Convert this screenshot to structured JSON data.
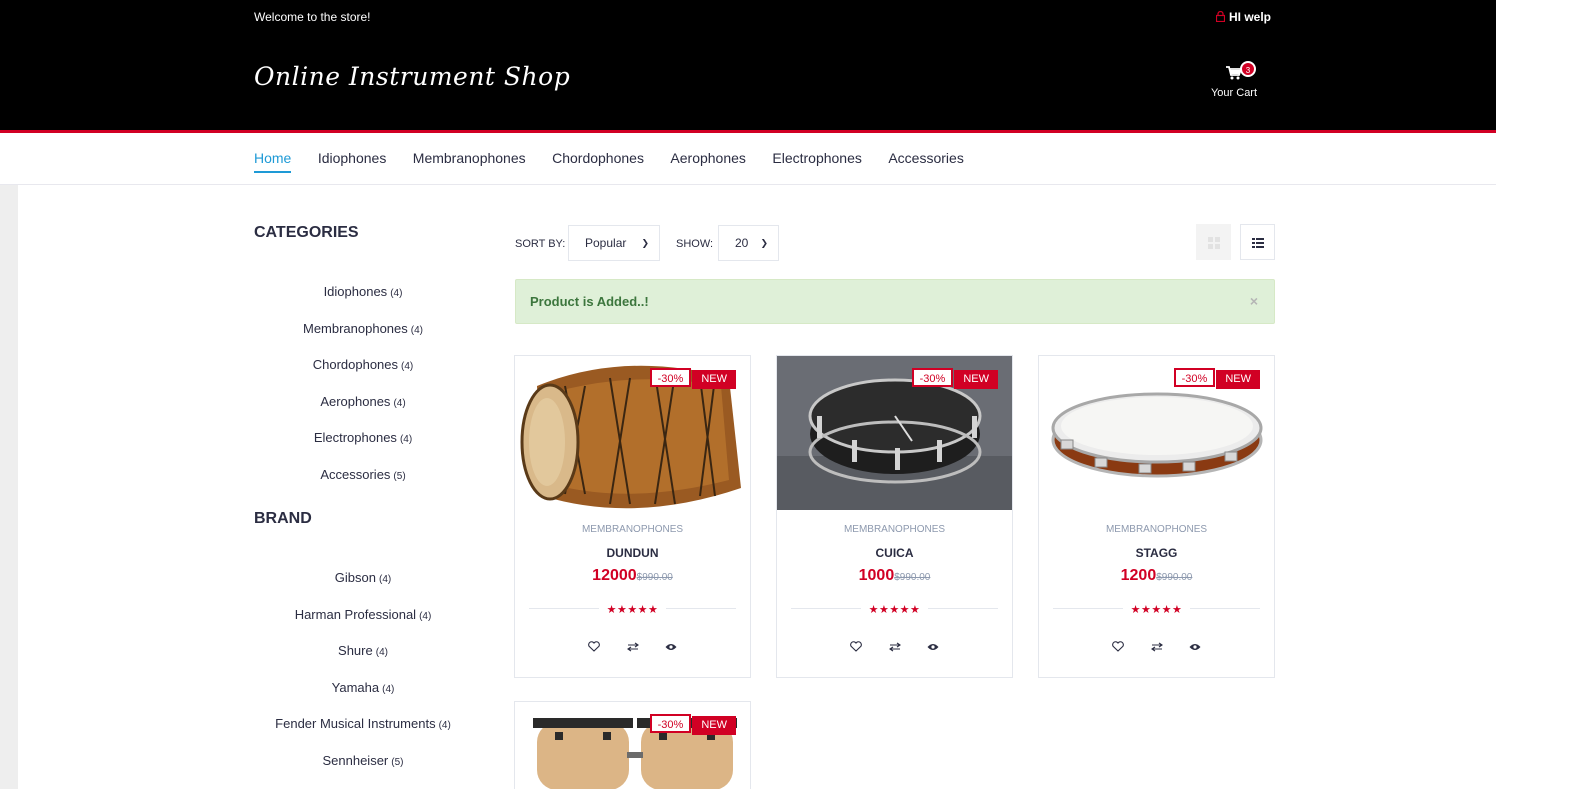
{
  "header": {
    "welcome": "Welcome to the store!",
    "account_greeting": "HI welp",
    "logo": "Online Instrument Shop",
    "cart_label": "Your Cart",
    "cart_count": "3"
  },
  "nav": {
    "items": [
      {
        "label": "Home",
        "active": true
      },
      {
        "label": "Idiophones"
      },
      {
        "label": "Membranophones"
      },
      {
        "label": "Chordophones"
      },
      {
        "label": "Aerophones"
      },
      {
        "label": "Electrophones"
      },
      {
        "label": "Accessories"
      }
    ]
  },
  "sidebar": {
    "categories_title": "CATEGORIES",
    "categories": [
      {
        "name": "Idiophones",
        "count": "(4)"
      },
      {
        "name": "Membranophones",
        "count": "(4)"
      },
      {
        "name": "Chordophones",
        "count": "(4)"
      },
      {
        "name": "Aerophones",
        "count": "(4)"
      },
      {
        "name": "Electrophones",
        "count": "(4)"
      },
      {
        "name": "Accessories",
        "count": "(5)"
      }
    ],
    "brand_title": "BRAND",
    "brands": [
      {
        "name": "Gibson",
        "count": "(4)"
      },
      {
        "name": "Harman Professional",
        "count": "(4)"
      },
      {
        "name": "Shure",
        "count": "(4)"
      },
      {
        "name": "Yamaha",
        "count": "(4)"
      },
      {
        "name": "Fender Musical Instruments",
        "count": "(4)"
      },
      {
        "name": "Sennheiser",
        "count": "(5)"
      }
    ]
  },
  "store_filter": {
    "sort_label": "SORT BY:",
    "sort_value": "Popular",
    "show_label": "SHOW:",
    "show_value": "20"
  },
  "alert": {
    "message": "Product is Added..!",
    "close": "×"
  },
  "products": [
    {
      "sale": "-30%",
      "new": "NEW",
      "category": "MEMBRANOPHONES",
      "name": "DUNDUN",
      "price": "12000",
      "old_price": "$990.00",
      "stars": "★★★★★"
    },
    {
      "sale": "-30%",
      "new": "NEW",
      "category": "MEMBRANOPHONES",
      "name": "CUICA",
      "price": "1000",
      "old_price": "$990.00",
      "stars": "★★★★★"
    },
    {
      "sale": "-30%",
      "new": "NEW",
      "category": "MEMBRANOPHONES",
      "name": "STAGG",
      "price": "1200",
      "old_price": "$990.00",
      "stars": "★★★★★"
    },
    {
      "sale": "-30%",
      "new": "NEW"
    }
  ],
  "colors": {
    "primary_red": "#d10024",
    "header_bg": "#000000",
    "nav_active": "#1e9ad6",
    "alert_bg": "#dff0d8",
    "alert_text": "#3c763d"
  },
  "icons": {
    "account": "lock-icon",
    "cart": "shopping-cart-icon",
    "grid_view": "grid-icon",
    "list_view": "list-icon",
    "wishlist": "heart-icon",
    "compare": "exchange-icon",
    "quick_view": "eye-icon"
  }
}
